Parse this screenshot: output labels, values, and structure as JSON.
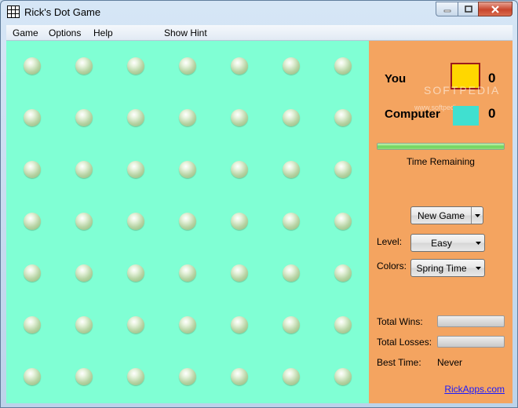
{
  "window": {
    "title": "Rick's Dot Game"
  },
  "menu": {
    "items": [
      "Game",
      "Options",
      "Help",
      "Show Hint"
    ]
  },
  "board": {
    "rows": 7,
    "cols": 7
  },
  "scores": {
    "you": {
      "label": "You",
      "value": "0",
      "color": "#ffd700"
    },
    "computer": {
      "label": "Computer",
      "value": "0",
      "color": "#40e0d0"
    }
  },
  "watermark": {
    "text": "SOFTPEDIA",
    "url": "www.softpedia.com"
  },
  "timer": {
    "label": "Time Remaining",
    "progress": 1.0
  },
  "controls": {
    "new_game_label": "New Game",
    "level_label": "Level:",
    "level_value": "Easy",
    "colors_label": "Colors:",
    "colors_value": "Spring Time"
  },
  "stats": {
    "wins_label": "Total Wins:",
    "wins_progress": 0,
    "losses_label": "Total Losses:",
    "losses_progress": 0,
    "best_time_label": "Best Time:",
    "best_time_value": "Never"
  },
  "footer": {
    "link": "RickApps.com"
  },
  "colors": {
    "board": "#80ffd4",
    "panel": "#f4a460",
    "link": "#1a1aff"
  }
}
